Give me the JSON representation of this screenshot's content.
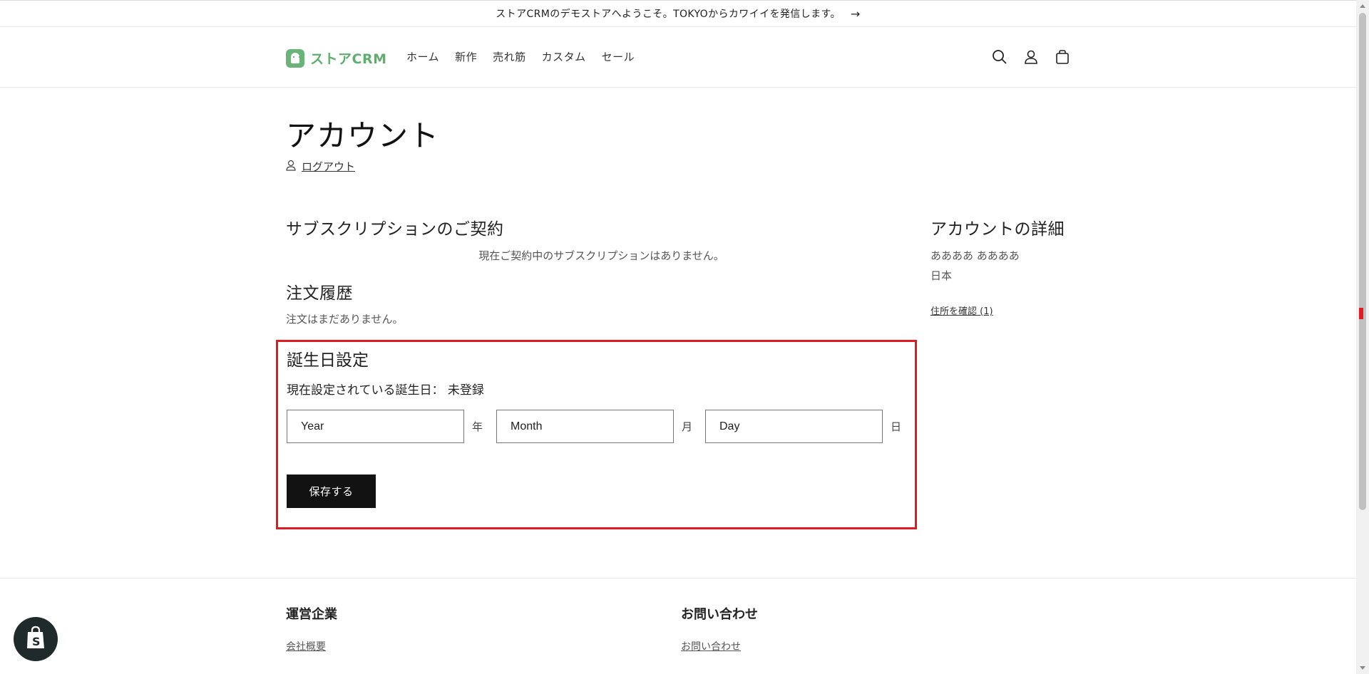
{
  "announcement": {
    "text": "ストアCRMのデモストアへようこそ。TOKYOからカワイイを発信します。",
    "arrow": "→"
  },
  "header": {
    "logo_text": "ストアCRM",
    "nav": [
      "ホーム",
      "新作",
      "売れ筋",
      "カスタム",
      "セール"
    ],
    "icons": [
      "search-icon",
      "account-icon",
      "cart-icon"
    ]
  },
  "account": {
    "title": "アカウント",
    "logout_label": "ログアウト"
  },
  "subscriptions": {
    "title": "サブスクリプションのご契約",
    "empty_text": "現在ご契約中のサブスクリプションはありません。"
  },
  "orders": {
    "title": "注文履歴",
    "empty_text": "注文はまだありません。"
  },
  "details": {
    "title": "アカウントの詳細",
    "name": "ああああ ああああ",
    "country": "日本",
    "addresses_link": "住所を確認 (1)"
  },
  "birthday": {
    "title": "誕生日設定",
    "current_text": "現在設定されている誕生日： 未登録",
    "year_placeholder": "Year",
    "year_unit": "年",
    "month_placeholder": "Month",
    "month_unit": "月",
    "day_placeholder": "Day",
    "day_unit": "日",
    "save_label": "保存する",
    "highlight_color": "#e01b22"
  },
  "footer": {
    "col1_title": "運営企業",
    "col1_link": "会社概要",
    "col2_title": "お問い合わせ",
    "col2_link": "お問い合わせ"
  }
}
